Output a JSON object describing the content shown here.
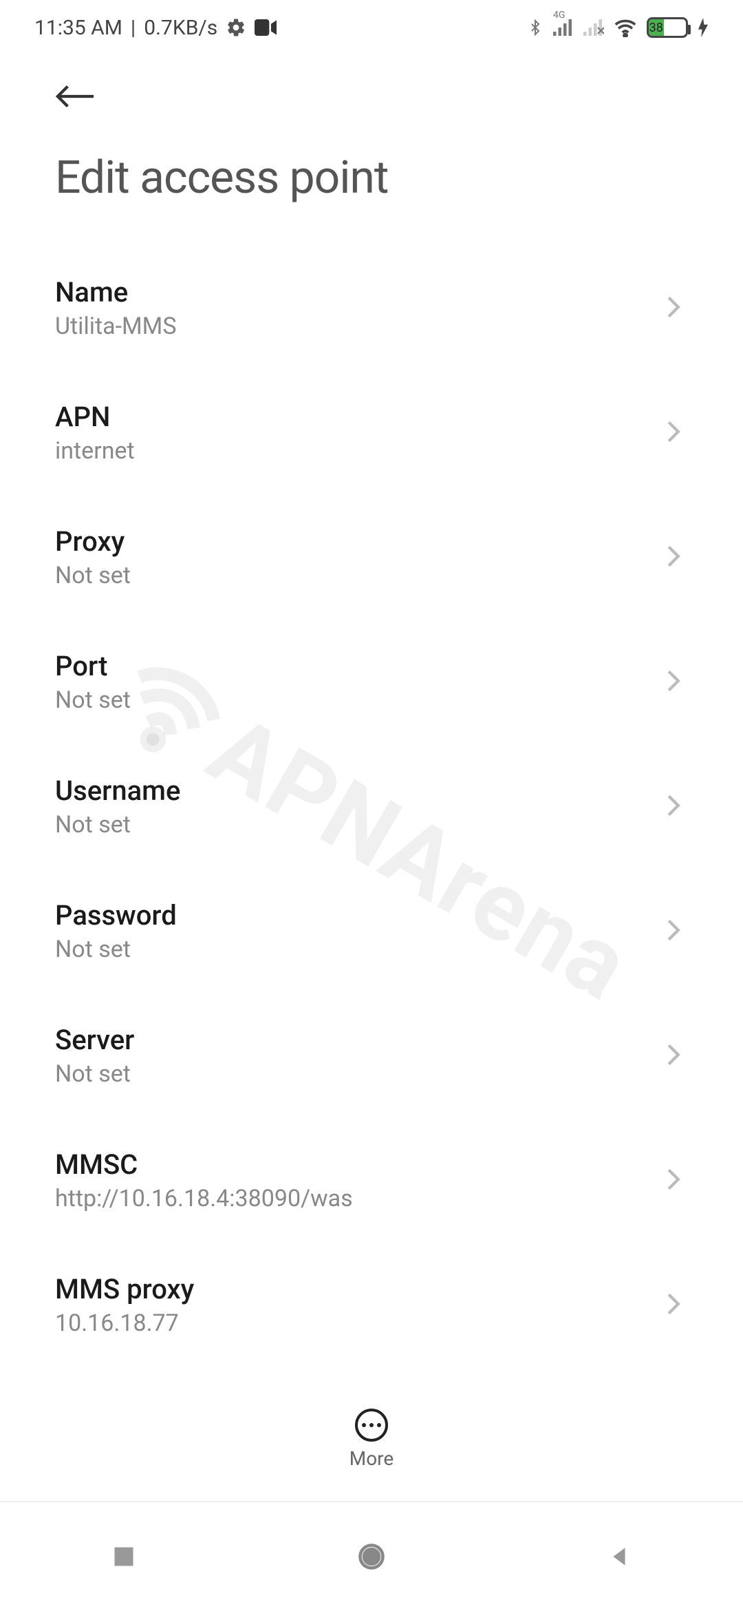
{
  "status": {
    "time": "11:35 AM",
    "speed": "0.7KB/s",
    "network_label": "4G",
    "battery_percent": "38"
  },
  "header": {
    "title": "Edit access point"
  },
  "rows": [
    {
      "title": "Name",
      "sub": "Utilita-MMS"
    },
    {
      "title": "APN",
      "sub": "internet"
    },
    {
      "title": "Proxy",
      "sub": "Not set"
    },
    {
      "title": "Port",
      "sub": "Not set"
    },
    {
      "title": "Username",
      "sub": "Not set"
    },
    {
      "title": "Password",
      "sub": "Not set"
    },
    {
      "title": "Server",
      "sub": "Not set"
    },
    {
      "title": "MMSC",
      "sub": "http://10.16.18.4:38090/was"
    },
    {
      "title": "MMS proxy",
      "sub": "10.16.18.77"
    }
  ],
  "bottom": {
    "more_label": "More"
  },
  "watermark": "APNArena"
}
